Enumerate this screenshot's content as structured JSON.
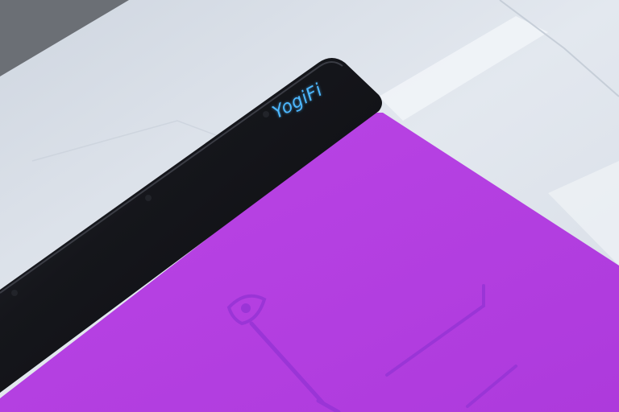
{
  "scene": {
    "brand_text": "YogiFi",
    "colors": {
      "mat": "#b43fe0",
      "mat_lines": "#9a35d6",
      "mat_case": "#15161b",
      "brand_led": "#4db8ff",
      "floor_dark": "#6b6f75",
      "paper": "#dfe4ec"
    },
    "objects": [
      "floor",
      "paper-sheets",
      "tape-strip",
      "yoga-mat",
      "mat-sensor-case",
      "brand-logo",
      "alignment-lines",
      "alignment-marker"
    ]
  }
}
